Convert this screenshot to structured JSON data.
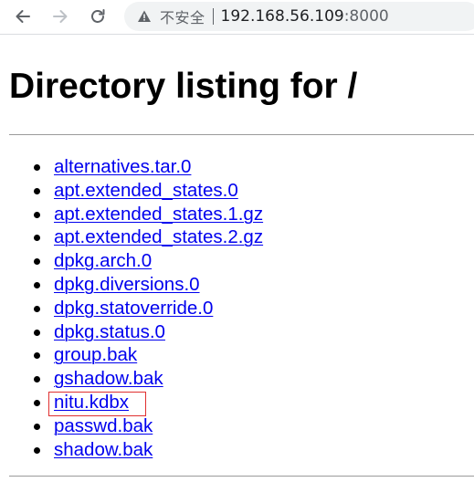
{
  "browser": {
    "security_label": "不安全",
    "url_host": "192.168.56.109",
    "url_port": ":8000"
  },
  "page": {
    "title": "Directory listing for /",
    "files": [
      "alternatives.tar.0",
      "apt.extended_states.0",
      "apt.extended_states.1.gz",
      "apt.extended_states.2.gz",
      "dpkg.arch.0",
      "dpkg.diversions.0",
      "dpkg.statoverride.0",
      "dpkg.status.0",
      "group.bak",
      "gshadow.bak",
      "nitu.kdbx",
      "passwd.bak",
      "shadow.bak"
    ]
  },
  "icons": {
    "back": "arrow-left-icon",
    "forward": "arrow-right-icon",
    "reload": "reload-icon",
    "security": "warning-triangle-icon"
  },
  "colors": {
    "link": "#0000ee",
    "highlight_box": "#e03030",
    "omnibox_bg": "#f1f3f4"
  }
}
